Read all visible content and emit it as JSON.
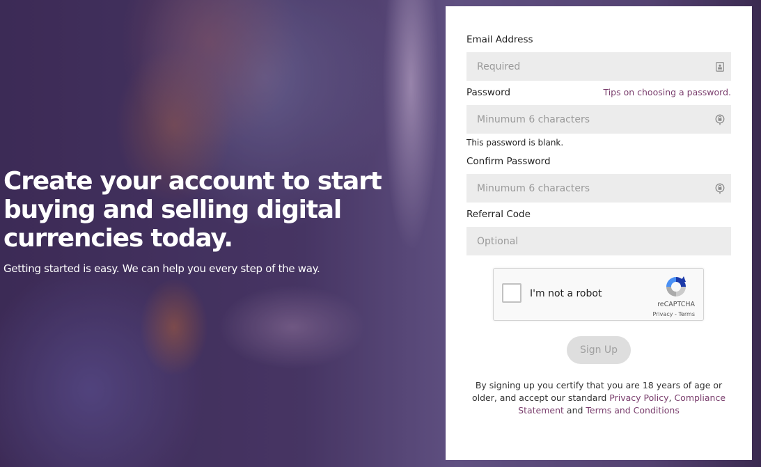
{
  "hero": {
    "headline": "Create your account to start buying and selling digital currencies today.",
    "subtext": "Getting started is easy. We can help you every step of the way."
  },
  "form": {
    "email": {
      "label": "Email Address",
      "placeholder": "Required",
      "value": "",
      "icon": "contact-card-icon"
    },
    "password": {
      "label": "Password",
      "tips_link": "Tips on choosing a password.",
      "placeholder": "Minumum 6 characters",
      "value": "",
      "icon": "password-lock-icon",
      "error": "This password is blank."
    },
    "confirm_password": {
      "label": "Confirm Password",
      "placeholder": "Minumum 6 characters",
      "value": "",
      "icon": "password-lock-icon"
    },
    "referral": {
      "label": "Referral Code",
      "placeholder": "Optional",
      "value": ""
    },
    "captcha": {
      "label": "I'm not a robot",
      "checked": false,
      "brand": "reCAPTCHA",
      "privacy": "Privacy",
      "separator": " - ",
      "terms": "Terms"
    },
    "submit_label": "Sign Up",
    "legal": {
      "prefix": "By signing up you certify that you are 18 years of age or older, and accept our standard ",
      "privacy_link": "Privacy Policy",
      "comma": ", ",
      "compliance_link": "Compliance Statement",
      "and": " and ",
      "terms_link": "Terms and Conditions"
    }
  },
  "colors": {
    "link": "#7a3e6d",
    "field_bg": "#ececec",
    "button_bg": "#dedede",
    "panel_bg": "#ffffff"
  }
}
